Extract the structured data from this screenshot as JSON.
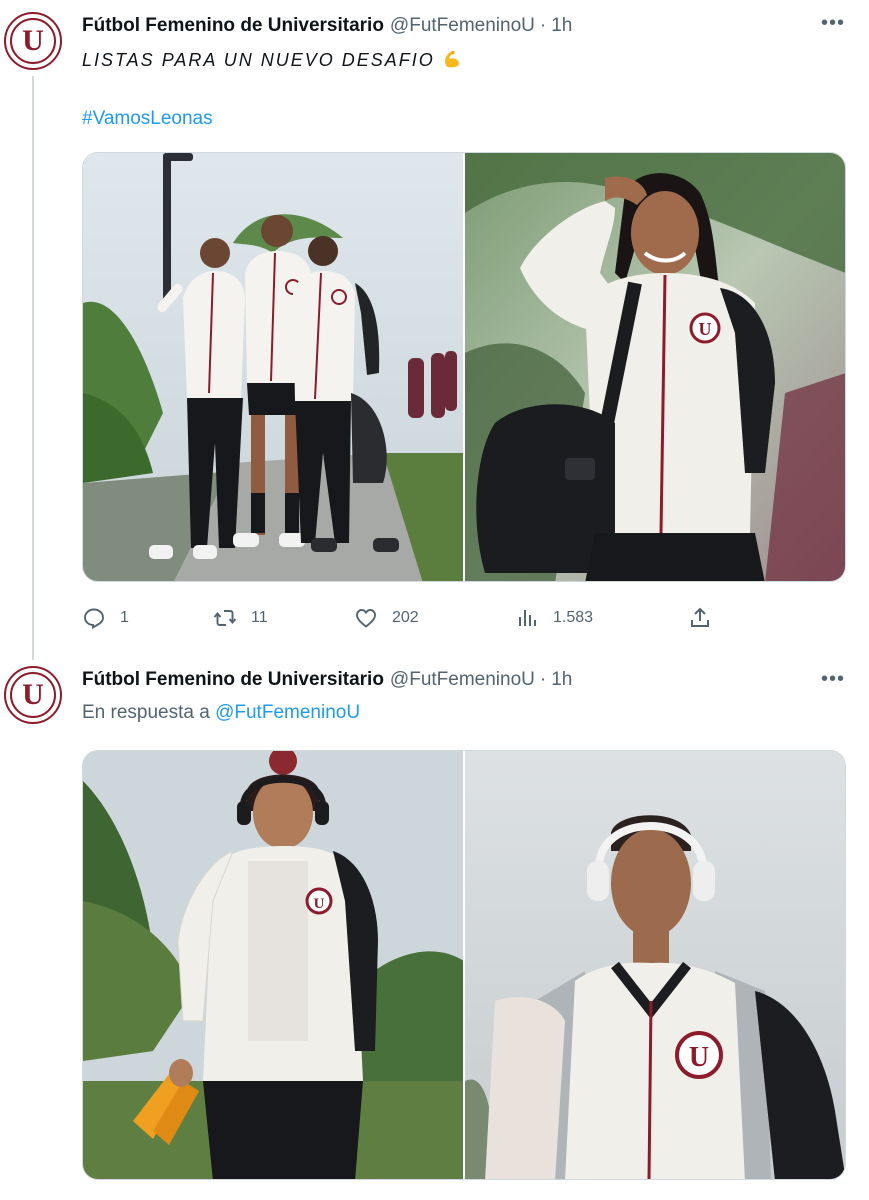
{
  "tweets": [
    {
      "display_name": "Fútbol Femenino de Universitario",
      "handle": "@FutFemeninoU",
      "separator": "·",
      "time": "1h",
      "more": "•••",
      "avatar_letter": "U",
      "text": "LISTAS PARA UN NUEVO DESAFIO",
      "emoji": "flexed-biceps-icon",
      "hashtag": "#VamosLeonas",
      "photos": [
        "photo-three-players-walking",
        "photo-player-saluting"
      ],
      "metrics": {
        "replies": "1",
        "retweets": "11",
        "likes": "202",
        "views": "1.583"
      }
    },
    {
      "display_name": "Fútbol Femenino de Universitario",
      "handle": "@FutFemeninoU",
      "separator": "·",
      "time": "1h",
      "more": "•••",
      "avatar_letter": "U",
      "reply_prefix": "En respuesta a",
      "reply_to": "@FutFemeninoU",
      "photos": [
        "photo-player-headphones-boots",
        "photo-player-white-headphones"
      ]
    }
  ],
  "icons": {
    "reply": "reply-icon",
    "retweet": "retweet-icon",
    "like": "heart-icon",
    "views": "views-icon",
    "share": "share-icon"
  },
  "colors": {
    "club_maroon": "#8c1c2b",
    "link_blue": "#1d9bf0",
    "muted": "#536471"
  }
}
